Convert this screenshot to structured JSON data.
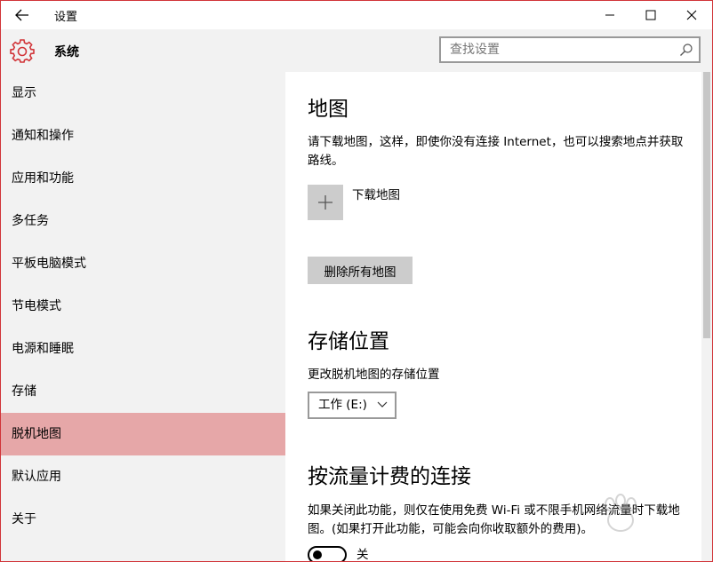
{
  "window": {
    "title": "设置"
  },
  "header": {
    "title": "系统"
  },
  "search": {
    "placeholder": "查找设置"
  },
  "sidebar": {
    "items": [
      {
        "label": "显示"
      },
      {
        "label": "通知和操作"
      },
      {
        "label": "应用和功能"
      },
      {
        "label": "多任务"
      },
      {
        "label": "平板电脑模式"
      },
      {
        "label": "节电模式"
      },
      {
        "label": "电源和睡眠"
      },
      {
        "label": "存储"
      },
      {
        "label": "脱机地图",
        "selected": true
      },
      {
        "label": "默认应用"
      },
      {
        "label": "关于"
      }
    ]
  },
  "maps": {
    "heading": "地图",
    "description": "请下载地图，这样，即使你没有连接 Internet，也可以搜索地点并获取路线。",
    "download_label": "下载地图",
    "delete_all_label": "删除所有地图"
  },
  "storage": {
    "heading": "存储位置",
    "description": "更改脱机地图的存储位置",
    "selected_drive": "工作 (E:)"
  },
  "metered": {
    "heading": "按流量计费的连接",
    "description": "如果关闭此功能，则仅在使用免费 Wi-Fi 或不限手机网络流量时下载地图。(如果打开此功能，可能会向你收取额外的费用)。",
    "toggle_state": "关",
    "toggle_on": false
  },
  "colors": {
    "accent": "#d13438",
    "selected_item": "#e6a7a8",
    "sidebar_bg": "#f2f2f2",
    "content_bg": "#ffffff",
    "button_gray": "#cccccc"
  },
  "icons": {
    "back": "back-arrow-icon",
    "gear": "gear-icon",
    "search": "search-icon",
    "minimize": "minimize-icon",
    "maximize": "maximize-icon",
    "close": "close-icon",
    "plus": "plus-icon",
    "dropdown": "chevron-down-icon"
  }
}
